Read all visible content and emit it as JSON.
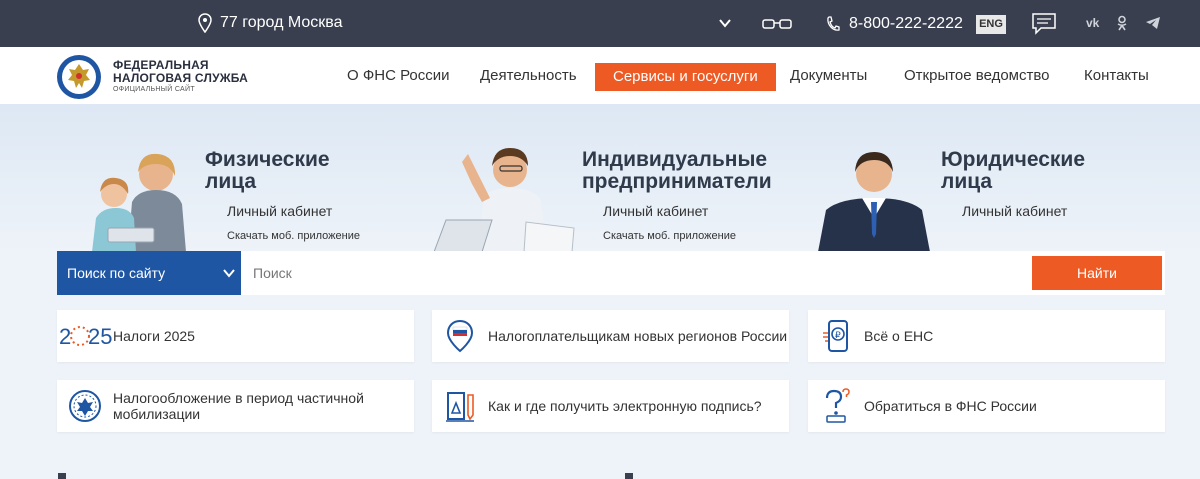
{
  "topbar": {
    "location": "77 город Москва",
    "phone": "8-800-222-2222",
    "lang_button": "ENG",
    "social": [
      "vk-icon",
      "ok-icon",
      "telegram-icon"
    ]
  },
  "header": {
    "logo_line1": "ФЕДЕРАЛЬНАЯ",
    "logo_line2": "НАЛОГОВАЯ СЛУЖБА",
    "logo_line3": "ОФИЦИАЛЬНЫЙ САЙТ",
    "nav": [
      "О ФНС России",
      "Деятельность",
      "Сервисы и госуслуги",
      "Документы",
      "Открытое ведомство",
      "Контакты"
    ],
    "active_nav": "Сервисы и госуслуги",
    "accent": "#ee5a24"
  },
  "hero": [
    {
      "title_l1": "Физические",
      "title_l2": "лица",
      "link1": "Личный кабинет",
      "link2": "Скачать моб. приложение"
    },
    {
      "title_l1": "Индивидуальные",
      "title_l2": "предприниматели",
      "link1": "Личный кабинет",
      "link2": "Скачать моб. приложение"
    },
    {
      "title_l1": "Юридические",
      "title_l2": "лица",
      "link1": "Личный кабинет"
    }
  ],
  "search": {
    "scope": "Поиск по сайту",
    "placeholder": "Поиск",
    "button": "Найти",
    "scope_color": "#1f56a3"
  },
  "tiles": [
    {
      "label": "Налоги 2025",
      "icon": "2025-icon"
    },
    {
      "label": "Налогоплательщикам новых регионов России",
      "icon": "map-pin-flag-icon"
    },
    {
      "label": "Всё о ЕНС",
      "icon": "phone-ruble-icon"
    },
    {
      "label": "Налогообложение в период частичной мобилизации",
      "icon": "emblem-icon"
    },
    {
      "label": "Как и где получить электронную подпись?",
      "icon": "signature-icon"
    },
    {
      "label": "Обратиться в ФНС России",
      "icon": "question-icon"
    }
  ]
}
